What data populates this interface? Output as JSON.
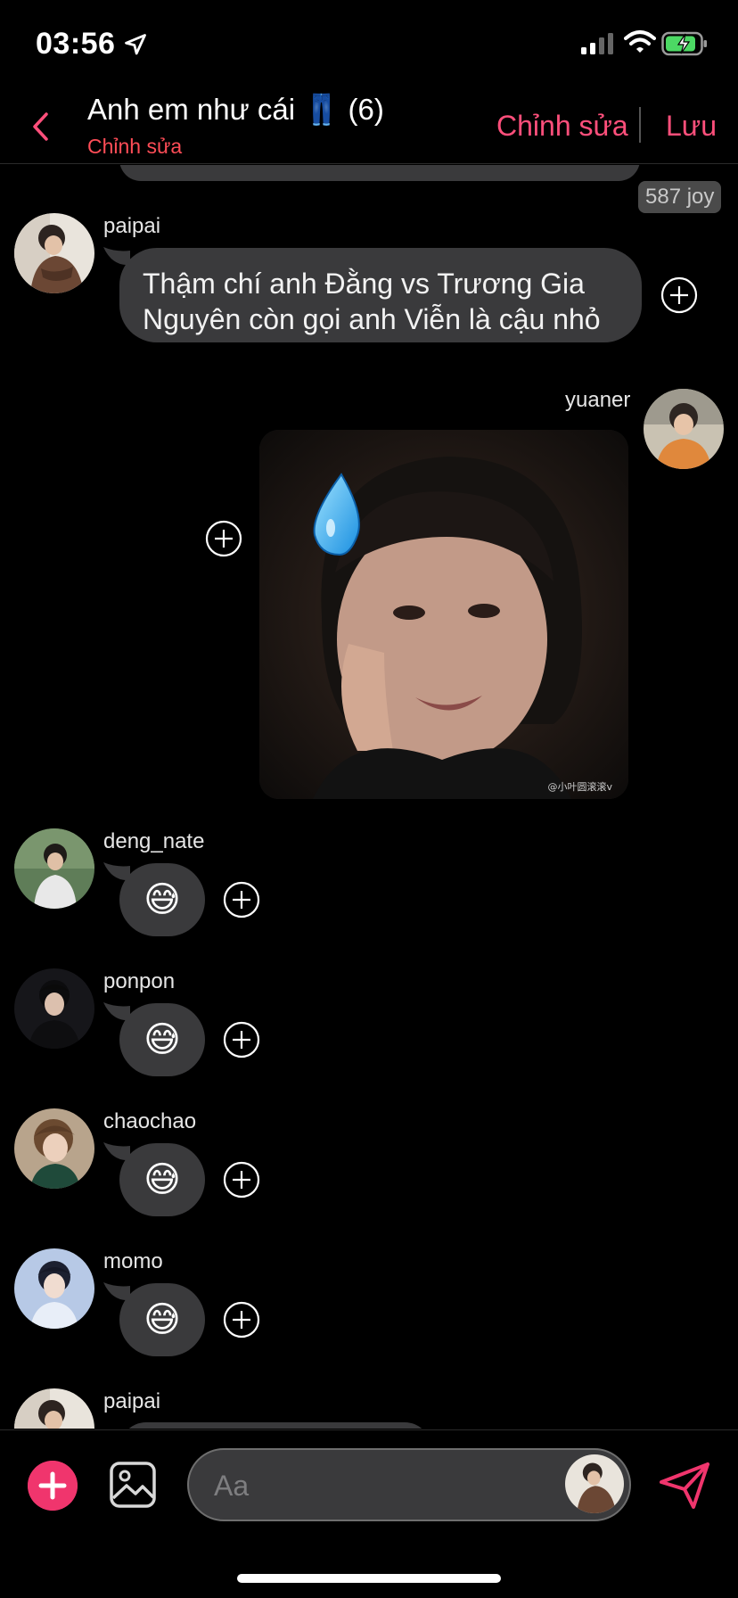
{
  "status_bar": {
    "time": "03:56"
  },
  "header": {
    "title": "Anh em như cái 👖 (6)",
    "subtitle": "Chỉnh sửa",
    "edit_label": "Chỉnh sửa",
    "save_label": "Lưu"
  },
  "tiny_badge": "587 joy",
  "messages": [
    {
      "sender": "paipai",
      "type": "text",
      "text_line1": "Thậm chí anh Đằng vs Trương Gia",
      "text_line2": "Nguyên còn gọi anh Viễn là cậu nhỏ"
    },
    {
      "sender": "yuaner",
      "type": "image",
      "watermark": "@小叶圆滚滚v"
    },
    {
      "sender": "deng_nate",
      "type": "emoji",
      "emoji": "😅"
    },
    {
      "sender": "ponpon",
      "type": "emoji",
      "emoji": "😅"
    },
    {
      "sender": "chaochao",
      "type": "emoji",
      "emoji": "😅"
    },
    {
      "sender": "momo",
      "type": "emoji",
      "emoji": "😅"
    },
    {
      "sender": "paipai",
      "type": "text-cut"
    }
  ],
  "composer": {
    "placeholder": "Aa"
  },
  "colors": {
    "accent": "#ff4f7b",
    "subtitle": "#ff4d57",
    "bubble": "#3a3a3c",
    "plus_button": "#f0356d"
  }
}
